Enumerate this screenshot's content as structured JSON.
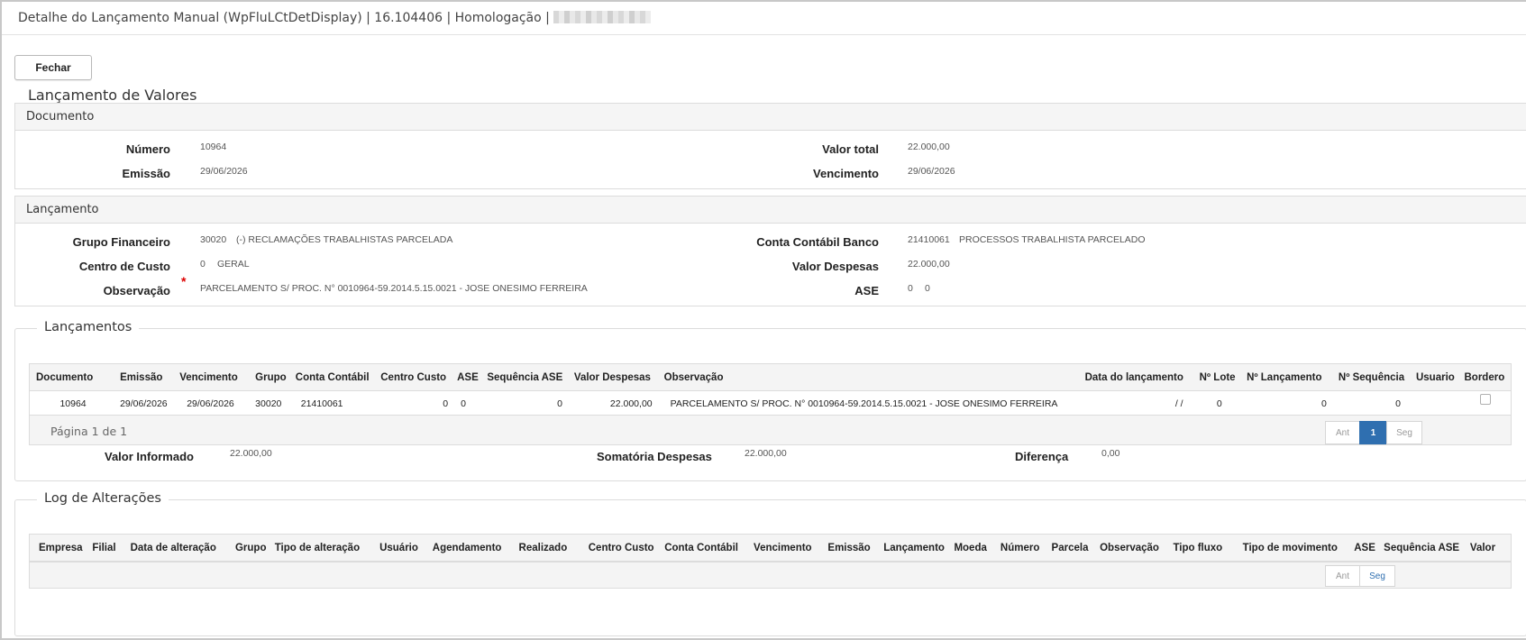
{
  "window": {
    "title": "Detalhe do Lançamento Manual (WpFluLCtDetDisplay) | 16.104406 | Homologação |"
  },
  "actions": {
    "close_label": "Fechar"
  },
  "page_title": "Lançamento de Valores",
  "documento": {
    "header": "Documento",
    "numero_label": "Número",
    "numero_value": "10964",
    "emissao_label": "Emissão",
    "emissao_value": "29/06/2026",
    "valor_total_label": "Valor total",
    "valor_total_value": "22.000,00",
    "vencimento_label": "Vencimento",
    "vencimento_value": "29/06/2026"
  },
  "lancamento": {
    "header": "Lançamento",
    "grupo_label": "Grupo Financeiro",
    "grupo_code": "30020",
    "grupo_desc": "(-) RECLAMAÇÕES TRABALHISTAS PARCELADA",
    "centro_label": "Centro de Custo",
    "centro_code": "0",
    "centro_desc": "GERAL",
    "obs_label": "Observação",
    "obs_required": "*",
    "obs_value": "PARCELAMENTO S/ PROC. N° 0010964-59.2014.5.15.0021 - JOSE ONESIMO FERREIRA",
    "conta_label": "Conta Contábil Banco",
    "conta_code": "21410061",
    "conta_desc": "PROCESSOS TRABALHISTA PARCELADO",
    "despesas_label": "Valor Despesas",
    "despesas_value": "22.000,00",
    "ase_label": "ASE",
    "ase_value1": "0",
    "ase_value2": "0"
  },
  "lancamentos": {
    "legend": "Lançamentos",
    "columns": [
      "Documento",
      "Emissão",
      "Vencimento",
      "Grupo",
      "Conta Contábil",
      "Centro Custo",
      "ASE",
      "Sequência ASE",
      "Valor Despesas",
      "Observação",
      "Data do lançamento",
      "Nº Lote",
      "Nº Lançamento",
      "Nº Sequência",
      "Usuario",
      "Bordero"
    ],
    "row": {
      "documento": "10964",
      "emissao": "29/06/2026",
      "vencimento": "29/06/2026",
      "grupo": "30020",
      "conta": "21410061",
      "centro": "0",
      "ase": "0",
      "seq_ase": "0",
      "valor": "22.000,00",
      "obs": "PARCELAMENTO S/ PROC. N° 0010964-59.2014.5.15.0021 - JOSE ONESIMO FERREIRA",
      "data": "/ /",
      "lote": "0",
      "lanc": "0",
      "seq": "0",
      "usuario": "",
      "bordero_checked": false
    },
    "pager": {
      "text": "Página 1 de 1",
      "prev": "Ant",
      "page": "1",
      "next": "Seg"
    },
    "valor_informado_label": "Valor Informado",
    "valor_informado_value": "22.000,00",
    "somatoria_label": "Somatória Despesas",
    "somatoria_value": "22.000,00",
    "diferenca_label": "Diferença",
    "diferenca_value": "0,00"
  },
  "log": {
    "legend": "Log de Alterações",
    "columns": [
      "Empresa",
      "Filial",
      "Data de alteração",
      "Grupo",
      "Tipo de alteração",
      "Usuário",
      "Agendamento",
      "Realizado",
      "Centro Custo",
      "Conta Contábil",
      "Vencimento",
      "Emissão",
      "Lançamento",
      "Moeda",
      "Número",
      "Parcela",
      "Observação",
      "Tipo fluxo",
      "Tipo de movimento",
      "ASE",
      "Sequência ASE",
      "Valor"
    ],
    "pager": {
      "prev": "Ant",
      "next": "Seg"
    }
  }
}
